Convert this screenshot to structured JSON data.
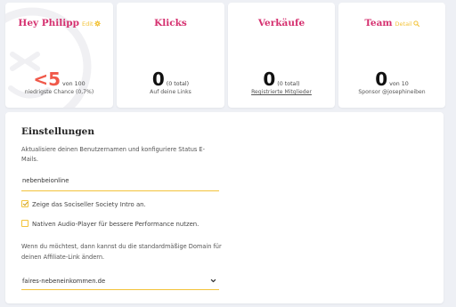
{
  "stats": [
    {
      "key": "hey",
      "title": "Hey Philipp",
      "extra": "Edit",
      "extra_icon": "gear-icon",
      "value": "<5",
      "value_suffix": "von 100",
      "subtitle": "niedrigste Chance (0,7%)"
    },
    {
      "key": "klicks",
      "title": "Klicks",
      "value": "0",
      "value_suffix": "(0 total)",
      "subtitle": "Auf deine Links"
    },
    {
      "key": "verkaeufe",
      "title": "Verkäufe",
      "value": "0",
      "value_suffix": "(0 total)",
      "subtitle": "Registrierte Mitglieder"
    },
    {
      "key": "team",
      "title": "Team",
      "extra": "Detail",
      "extra_icon": "search-icon",
      "value": "0",
      "value_suffix": "von 10",
      "subtitle": "Sponsor @josephineiben"
    }
  ],
  "settings": {
    "title": "Einstellungen",
    "description": "Aktualisiere deinen Benutzernamen und konfiguriere Status E-Mails.",
    "username_value": "nebenbeionline",
    "checkbox_intro_label": "Zeige das Sociseller Society Intro an.",
    "checkbox_intro_checked": true,
    "checkbox_audio_label": "Nativen Audio-Player für bessere Performance nutzen.",
    "checkbox_audio_checked": false,
    "domain_description": "Wenn du möchtest, dann kannst du die standardmäßige Domain für deinen Affiliate-Link ändern.",
    "domain_selected": "faires-nebeneinkommen.de"
  },
  "colors": {
    "accent_pink": "#d5306f",
    "accent_yellow": "#f3c33a",
    "value_red": "#f0594a",
    "background": "#eef0f5"
  }
}
